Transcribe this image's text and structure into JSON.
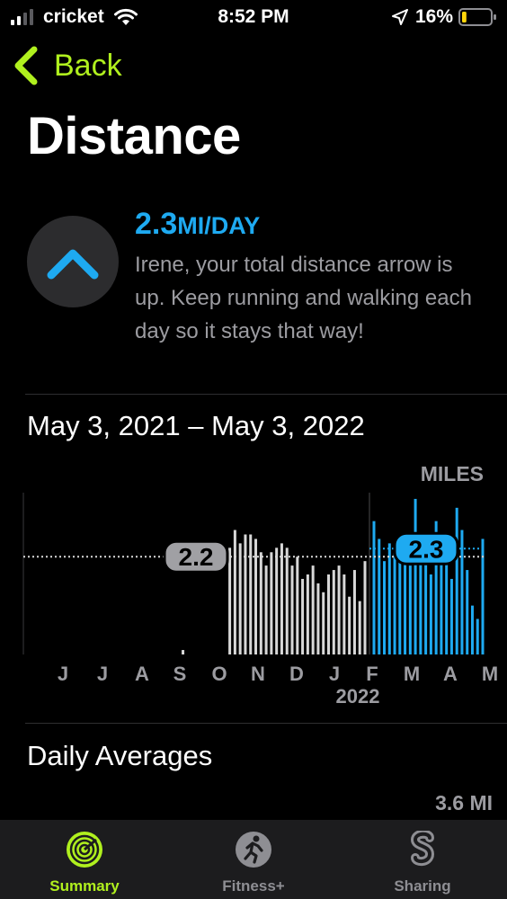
{
  "status_bar": {
    "carrier": "cricket",
    "time": "8:52 PM",
    "battery_percent": "16%",
    "battery_level": 0.16,
    "icons": [
      "signal-icon",
      "wifi-icon",
      "location-arrow-icon",
      "battery-icon"
    ]
  },
  "nav": {
    "back_label": "Back",
    "accent_color": "#b0f01e"
  },
  "page": {
    "title": "Distance"
  },
  "trend": {
    "direction": "up",
    "value": "2.3",
    "unit": "MI/DAY",
    "message": "Irene, your total distance arrow is up. Keep running and walking each day so it stays that way!",
    "color": "#1eaaf1"
  },
  "date_range": "May 3, 2021 – May 3, 2022",
  "chart_data": {
    "type": "bar",
    "units_label": "MILES",
    "x_tick_labels": [
      "J",
      "J",
      "A",
      "S",
      "O",
      "N",
      "D",
      "J",
      "F",
      "M",
      "A",
      "M"
    ],
    "year_label": "2022",
    "series": [
      {
        "period": "previous-365-days",
        "color": "#d8d8d8",
        "average": 2.2,
        "average_label": "2.2",
        "values": [
          0,
          0,
          0,
          0,
          0,
          0,
          0,
          0,
          0,
          0,
          0,
          0,
          0,
          0,
          0,
          0,
          0,
          0,
          0,
          0,
          0,
          0,
          0,
          0,
          0,
          0,
          0,
          0,
          0,
          0,
          0.1,
          0,
          0,
          0,
          0,
          0,
          0,
          0,
          0,
          2.4,
          2.8,
          2.5,
          2.7,
          2.7,
          2.6,
          2.3,
          2.0,
          2.3,
          2.4,
          2.5,
          2.4,
          2.0,
          2.2,
          1.7,
          1.8,
          2.0,
          1.6,
          1.4,
          1.8,
          1.9,
          2.0,
          1.8,
          1.3,
          1.9,
          1.2,
          2.1
        ]
      },
      {
        "period": "last-90-days",
        "color": "#1eaaf1",
        "average": 2.3,
        "average_label": "2.3",
        "values": [
          3.0,
          2.6,
          2.1,
          2.5,
          2.3,
          2.2,
          2.5,
          2.0,
          3.5,
          2.7,
          2.2,
          1.8,
          3.0,
          2.6,
          2.1,
          1.7,
          3.3,
          2.8,
          1.9,
          1.1,
          0.8,
          2.6
        ]
      }
    ],
    "ylim": [
      0,
      3.6
    ]
  },
  "averages": {
    "heading": "Daily Averages",
    "value": "3.6 MI"
  },
  "tabs": [
    {
      "label": "Summary",
      "icon": "activity-rings-icon",
      "active": true
    },
    {
      "label": "Fitness+",
      "icon": "fitness-plus-icon",
      "active": false
    },
    {
      "label": "Sharing",
      "icon": "sharing-icon",
      "active": false
    }
  ]
}
